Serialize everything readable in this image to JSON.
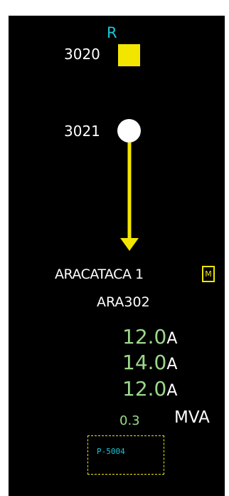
{
  "top_bus": {
    "marker": "R",
    "id": "3020"
  },
  "node": {
    "id": "3021"
  },
  "feeder": {
    "name": "ARACATACA 1",
    "code": "ARA302",
    "mode_indicator": "M"
  },
  "currents": [
    {
      "value": "12.0",
      "unit": "A"
    },
    {
      "value": "14.0",
      "unit": "A"
    },
    {
      "value": "12.0",
      "unit": "A"
    }
  ],
  "power": {
    "value": "0.3",
    "unit": "MVA"
  },
  "tag": {
    "label": "P-5004"
  },
  "colors": {
    "background": "#000000",
    "bus": "#f2e600",
    "arrow": "#f2e600",
    "value": "#9cd88a",
    "marker": "#18c6d6",
    "text": "#ffffff"
  }
}
